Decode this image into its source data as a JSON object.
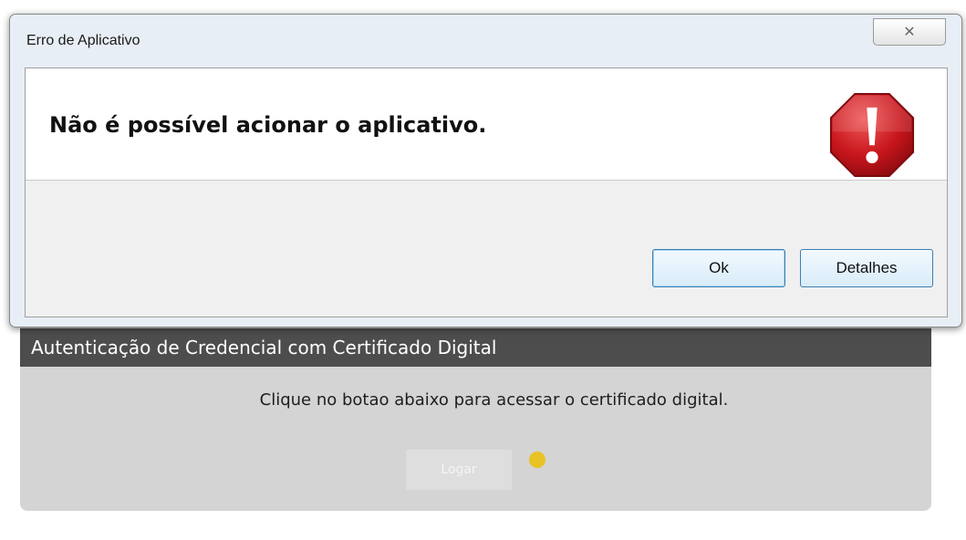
{
  "dialog": {
    "title": "Erro de Aplicativo",
    "close_glyph": "✕",
    "message": "Não é possível acionar o aplicativo.",
    "icon": "error-stop-icon",
    "buttons": {
      "ok": "Ok",
      "details": "Detalhes"
    }
  },
  "page": {
    "header": "Autenticação de Credencial com Certificado Digital",
    "instruction": "Clique no botao abaixo para acessar o certificado digital.",
    "login_button": "Logar",
    "status_color": "#e9c226"
  },
  "colors": {
    "panel_header": "#4d4d4d",
    "panel_background": "#d4d4d4",
    "error_icon": "#c8161c"
  }
}
